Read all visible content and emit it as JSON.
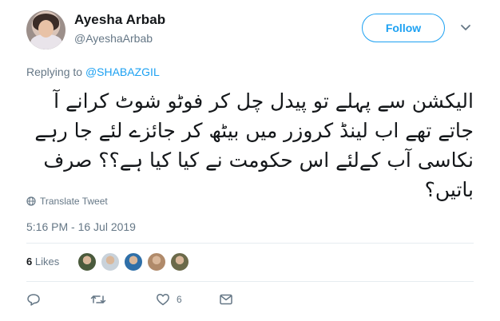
{
  "user": {
    "name": "Ayesha Arbab",
    "handle": "@AyeshaArbab"
  },
  "follow_button": {
    "label": "Follow"
  },
  "replying": {
    "prefix": "Replying to",
    "mention": "@SHABAZGIL"
  },
  "tweet": {
    "text": "الیکشن سے پہلے تو پیدل چل کر فوٹو شوٹ کرانے آ جاتے تھے اب لینڈ کروزر میں بیٹھ کر جائزے لئے جا رہے نکاسی آب کےلئے اس حکومت نے کیا کیا ہے؟؟ صرف باتیں؟"
  },
  "translate": {
    "label": "Translate Tweet"
  },
  "timestamp": "5:16 PM - 16 Jul 2019",
  "likes": {
    "count": "6",
    "label": "Likes",
    "liker_colors": [
      "#4a5a3c",
      "#c9d2da",
      "#2f6fa8",
      "#b08a6a",
      "#6b6a4a"
    ]
  },
  "actions": {
    "reply_icon": "reply-icon",
    "retweet_icon": "retweet-icon",
    "like_icon": "heart-icon",
    "like_count": "6",
    "dm_icon": "envelope-icon"
  },
  "colors": {
    "accent": "#1da1f2",
    "muted": "#657786",
    "text": "#14171a",
    "divider": "#e6ecf0"
  }
}
